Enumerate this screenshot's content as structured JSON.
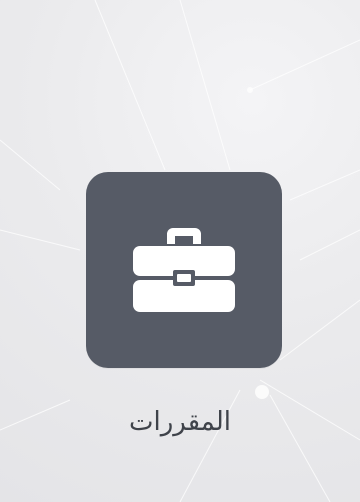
{
  "tile": {
    "label": "المقررات",
    "icon": "briefcase-icon",
    "background_color": "#565b66",
    "icon_color": "#ffffff"
  },
  "page": {
    "background_color": "#ececee"
  }
}
